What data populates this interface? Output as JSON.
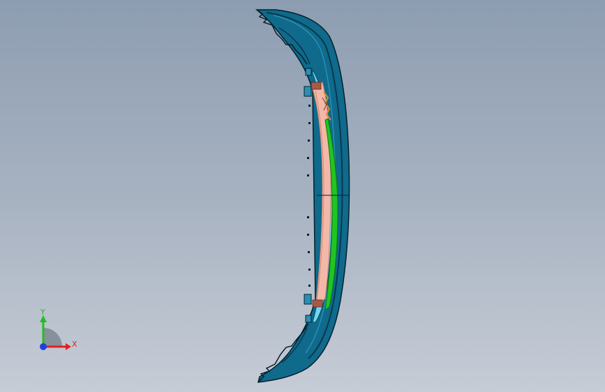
{
  "viewport": {
    "background_top": "#8d9db1",
    "background_bottom": "#c6ccd6"
  },
  "model": {
    "colors": {
      "shell": "#0f6a8c",
      "shell_dark": "#07394d",
      "edge": "#02202c",
      "inner_light": "#6fd6f0",
      "insert": "#f4b8a8",
      "insert_dark": "#c98270",
      "strip": "#22c422",
      "strip_dark": "#0d7a0d",
      "accent": "#e08a2a"
    }
  },
  "triad": {
    "x_label": "X",
    "y_label": "Y",
    "x_color": "#e02020",
    "y_color": "#20c020",
    "z_color": "#2040e0"
  }
}
